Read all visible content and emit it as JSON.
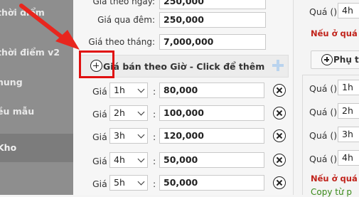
{
  "sidebar": {
    "items": [
      {
        "label": "thời điểm"
      },
      {
        "label": "thời điểm v2"
      },
      {
        "label": "hung"
      },
      {
        "label": "ều mẫu"
      },
      {
        "label": "Kho"
      }
    ]
  },
  "main": {
    "rows_top": [
      {
        "label": "Giá theo ngày:",
        "value": "250,000"
      },
      {
        "label": "Giá qua đêm:",
        "value": "250,000"
      },
      {
        "label": "Giá theo tháng:",
        "value": "7,000,000"
      }
    ],
    "section_title": "Giá bán theo Giờ - Click để thêm",
    "hourly": [
      {
        "label": "Giá",
        "hour": "1h",
        "value": "80,000"
      },
      {
        "label": "Giá",
        "hour": "2h",
        "value": "100,000"
      },
      {
        "label": "Giá",
        "hour": "3h",
        "value": "120,000"
      },
      {
        "label": "Giá",
        "hour": "4h",
        "value": "50,000"
      },
      {
        "label": "Giá",
        "hour": "5h",
        "value": "50,000"
      }
    ],
    "colon": ":"
  },
  "right": {
    "top_label": "Quá ()",
    "top_value": "4h",
    "note_top": "Nếu ở quá c",
    "sub_button": "Phụ tr",
    "rows": [
      {
        "label": "Quá ()",
        "value": "1h"
      },
      {
        "label": "Quá ()",
        "value": "2h"
      },
      {
        "label": "Quá ()",
        "value": "3h"
      },
      {
        "label": "Quá ()",
        "value": "4h"
      }
    ],
    "note_bottom": "Nếu ở quá c",
    "green_text": "Copy từ p"
  },
  "colors": {
    "highlight": "#e01010",
    "arrow": "#e8261e",
    "note": "#c0221a",
    "green": "#3a8a1a"
  }
}
